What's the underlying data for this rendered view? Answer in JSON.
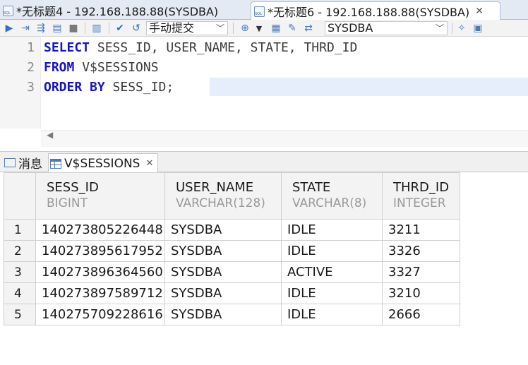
{
  "editor_tabs": [
    {
      "label": "*无标题4 - 192.168.188.88(SYSDBA)",
      "active": false
    },
    {
      "label": "*无标题6 - 192.168.188.88(SYSDBA)",
      "active": true
    }
  ],
  "toolbar": {
    "commit_mode": "手动提交",
    "schema": "SYSDBA"
  },
  "editor": {
    "line_numbers": [
      "1",
      "2",
      "3"
    ],
    "lines": [
      {
        "kw": "SELECT",
        "rest": " SESS_ID, USER_NAME, STATE, THRD_ID"
      },
      {
        "kw": "FROM",
        "rest": " V$SESSIONS"
      },
      {
        "kw": "ORDER BY",
        "rest": " SESS_ID;"
      }
    ]
  },
  "result_tabs": {
    "messages": "消息",
    "result": "V$SESSIONS"
  },
  "grid": {
    "columns": [
      {
        "name": "SESS_ID",
        "type": "BIGINT"
      },
      {
        "name": "USER_NAME",
        "type": "VARCHAR(128)"
      },
      {
        "name": "STATE",
        "type": "VARCHAR(8)"
      },
      {
        "name": "THRD_ID",
        "type": "INTEGER"
      }
    ],
    "rows": [
      {
        "n": "1",
        "cells": [
          "140273805226448",
          "SYSDBA",
          "IDLE",
          "3211"
        ]
      },
      {
        "n": "2",
        "cells": [
          "140273895617952",
          "SYSDBA",
          "IDLE",
          "3326"
        ]
      },
      {
        "n": "3",
        "cells": [
          "140273896364560",
          "SYSDBA",
          "ACTIVE",
          "3327"
        ]
      },
      {
        "n": "4",
        "cells": [
          "140273897589712",
          "SYSDBA",
          "IDLE",
          "3210"
        ]
      },
      {
        "n": "5",
        "cells": [
          "140275709228616",
          "SYSDBA",
          "IDLE",
          "2666"
        ]
      }
    ]
  }
}
